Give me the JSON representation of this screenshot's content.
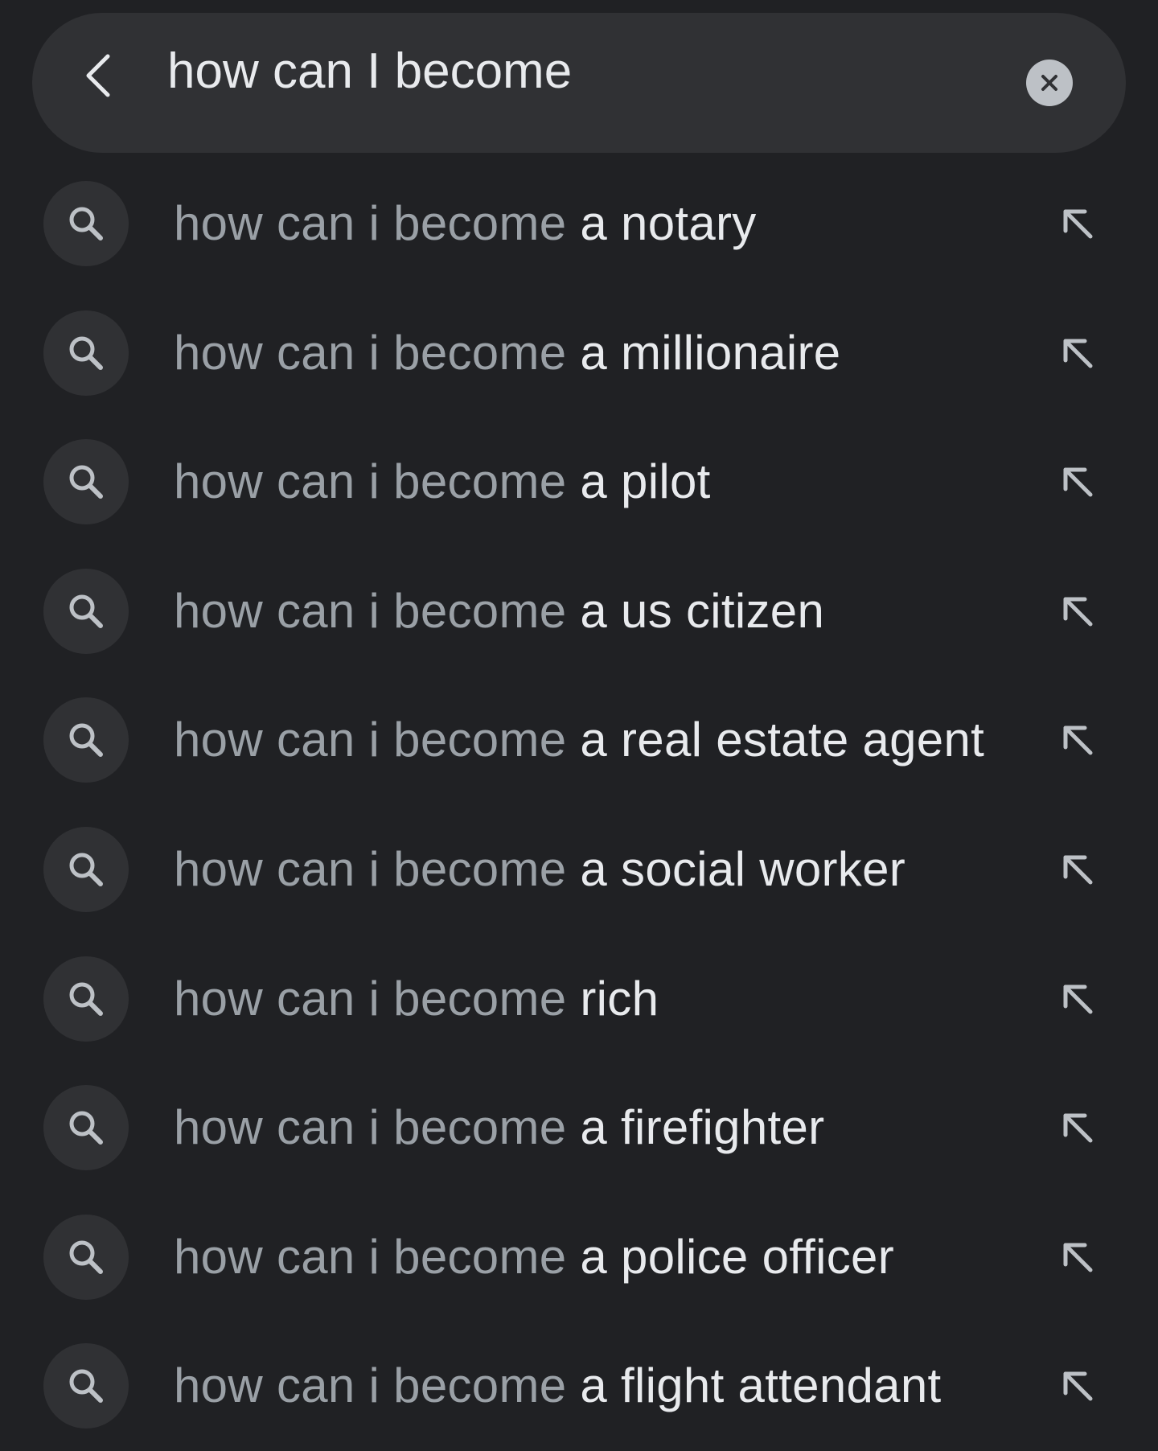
{
  "search": {
    "query": "how can I become",
    "back_icon": "chevron-left-icon",
    "clear_icon": "close-icon"
  },
  "suggestions": [
    {
      "prefix": "how can i become",
      "completion": "a notary"
    },
    {
      "prefix": "how can i become",
      "completion": "a millionaire"
    },
    {
      "prefix": "how can i become",
      "completion": "a pilot"
    },
    {
      "prefix": "how can i become",
      "completion": "a us citizen"
    },
    {
      "prefix": "how can i become",
      "completion": "a real estate agent"
    },
    {
      "prefix": "how can i become",
      "completion": "a social worker"
    },
    {
      "prefix": "how can i become",
      "completion": "rich"
    },
    {
      "prefix": "how can i become",
      "completion": "a firefighter"
    },
    {
      "prefix": "how can i become",
      "completion": "a police officer"
    },
    {
      "prefix": "how can i become",
      "completion": "a flight attendant"
    }
  ],
  "icons": {
    "suggestion": "search-icon",
    "fill": "arrow-up-left-icon"
  },
  "colors": {
    "background": "#202124",
    "surface": "#303134",
    "text_primary": "#e8eaed",
    "text_secondary": "#9aa0a6",
    "clear_button": "#bdc1c6"
  }
}
